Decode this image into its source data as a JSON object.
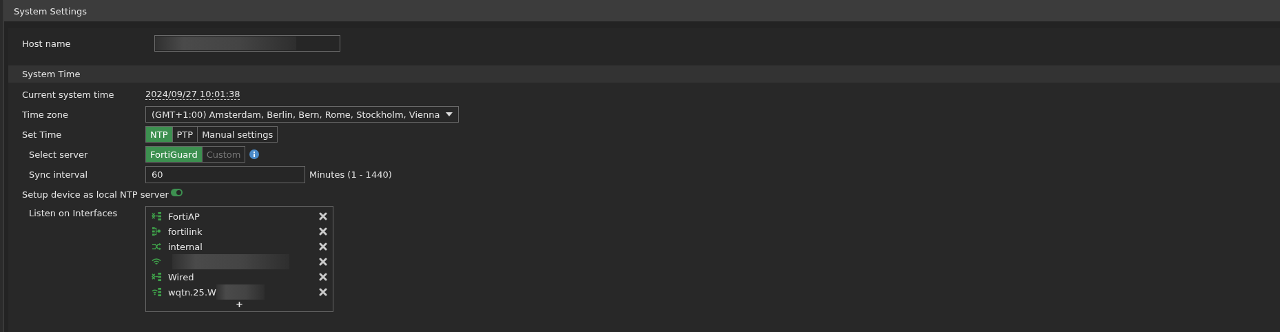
{
  "panel": {
    "title": "System Settings"
  },
  "host": {
    "label": "Host name",
    "redacted": true
  },
  "system_time": {
    "title": "System Time",
    "current": {
      "label": "Current system time",
      "value": "2024/09/27 10:01:38"
    },
    "time_zone": {
      "label": "Time zone",
      "value": "(GMT+1:00) Amsterdam, Berlin, Bern, Rome, Stockholm, Vienna"
    },
    "set_time": {
      "label": "Set Time",
      "options": [
        {
          "label": "NTP",
          "selected": true
        },
        {
          "label": "PTP",
          "selected": false
        },
        {
          "label": "Manual settings",
          "selected": false
        }
      ]
    },
    "select_server": {
      "label": "Select server",
      "options": [
        {
          "label": "FortiGuard",
          "selected": true
        },
        {
          "label": "Custom",
          "selected": false
        }
      ]
    },
    "sync_interval": {
      "label": "Sync interval",
      "value": "60",
      "unit": "Minutes (1 - 1440)"
    },
    "local_ntp": {
      "label": "Setup device as local NTP server",
      "on": true
    },
    "listen": {
      "label": "Listen on Interfaces",
      "items": [
        {
          "kind": "switch",
          "name": "FortiAP",
          "redacted": false
        },
        {
          "kind": "fortilink",
          "name": "fortilink",
          "redacted": false
        },
        {
          "kind": "shuffle",
          "name": "internal",
          "redacted": false
        },
        {
          "kind": "wifi",
          "redacted": true
        },
        {
          "kind": "switch",
          "name": "Wired",
          "redacted": false
        },
        {
          "kind": "wifi-switch",
          "name": "wqtn.25.W",
          "redacted": true
        }
      ],
      "add": "+"
    }
  }
}
